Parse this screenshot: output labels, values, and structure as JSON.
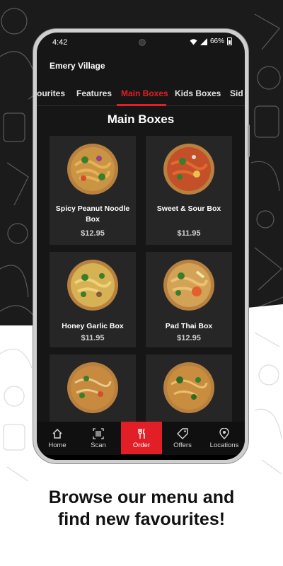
{
  "status_bar": {
    "time": "4:42",
    "battery": "66%"
  },
  "location": "Emery Village",
  "tabs": [
    {
      "label": "ourites"
    },
    {
      "label": "Features"
    },
    {
      "label": "Main Boxes"
    },
    {
      "label": "Kids Boxes"
    },
    {
      "label": "Sid"
    }
  ],
  "active_tab": "Main Boxes",
  "section_title": "Main Boxes",
  "menu_items": [
    {
      "name": "Spicy Peanut Noodle Box",
      "price": "$12.95"
    },
    {
      "name": "Sweet & Sour Box",
      "price": "$11.95"
    },
    {
      "name": "Honey Garlic Box",
      "price": "$11.95"
    },
    {
      "name": "Pad Thai Box",
      "price": "$12.95"
    },
    {
      "name": "",
      "price": ""
    },
    {
      "name": "",
      "price": ""
    }
  ],
  "bottom_nav": [
    {
      "label": "Home",
      "icon": "home-icon"
    },
    {
      "label": "Scan",
      "icon": "barcode-scan-icon"
    },
    {
      "label": "Order",
      "icon": "fork-knife-icon"
    },
    {
      "label": "Offers",
      "icon": "tag-icon"
    },
    {
      "label": "Locations",
      "icon": "map-pin-icon"
    }
  ],
  "tagline_line1": "Browse our menu and",
  "tagline_line2": "find new favourites!",
  "colors": {
    "accent": "#e21f26",
    "screen_bg": "#161616",
    "card_bg": "#262626",
    "promo_dark": "#1b1b1b"
  }
}
